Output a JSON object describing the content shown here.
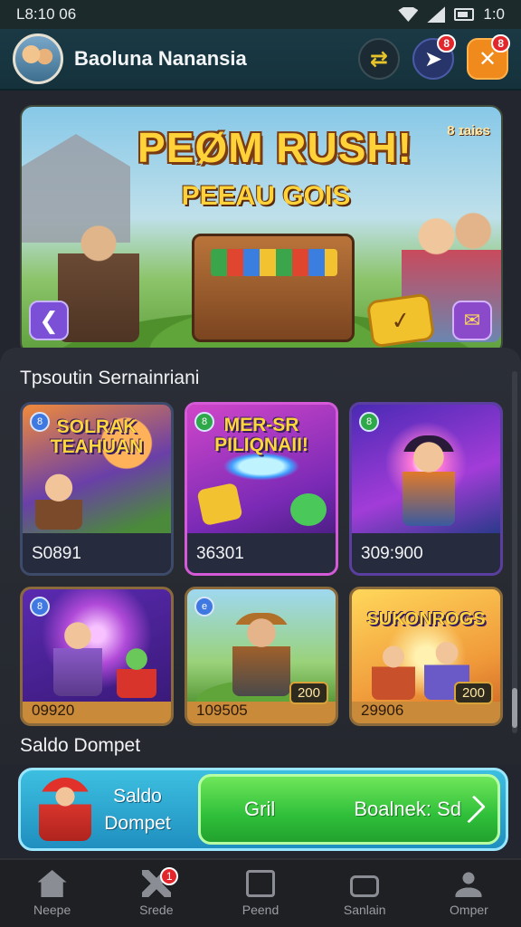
{
  "status_bar": {
    "time": "L8:10 06",
    "right_text": "1:0"
  },
  "header": {
    "username": "Baoluna Nanansia",
    "link_glyph": "⇄",
    "msg_glyph": "➤",
    "msg_badge": "8",
    "close_glyph": "✕",
    "close_badge": "8"
  },
  "banner": {
    "title": "PEØM RUSH!",
    "subtitle": "PEEAU GOIS",
    "tag": "8 ɪaiɕs",
    "back_glyph": "❮",
    "mail_glyph": "✉",
    "coin_glyph": "✓"
  },
  "section_title": "Tpsoutin Sernainriani",
  "games": [
    {
      "art_title": "SOLRAK TEAHUAN",
      "value": "S0891",
      "badge": "8"
    },
    {
      "art_title": "MER-SR PILIQNAII!",
      "value": "36301",
      "badge": "8"
    },
    {
      "art_title": "",
      "value": "309:900",
      "badge": "8"
    },
    {
      "art_title": "",
      "value": "09920",
      "badge": "8"
    },
    {
      "art_title": "",
      "value": "109505",
      "badge": "e",
      "price": "200"
    },
    {
      "art_title": "SUKONROGS",
      "value": "29906",
      "badge": "",
      "price": "200"
    }
  ],
  "wallet": {
    "section_label": "Saldo Dompet",
    "label_line1": "Saldo",
    "label_line2": "Dompet",
    "action_left": "Gril",
    "action_right": "Boalnek: Sd"
  },
  "bottom_nav": [
    {
      "label": "Neepe",
      "icon": "home-icon"
    },
    {
      "label": "Srede",
      "icon": "tools-icon",
      "badge": "1"
    },
    {
      "label": "Peend",
      "icon": "board-icon"
    },
    {
      "label": "Sanlain",
      "icon": "tv-icon"
    },
    {
      "label": "Omper",
      "icon": "user-icon"
    }
  ],
  "colors": {
    "accent_green": "#2fbf3a",
    "accent_blue": "#1f8fc0",
    "badge_red": "#e3262b",
    "title_gold": "#ffd23a"
  }
}
